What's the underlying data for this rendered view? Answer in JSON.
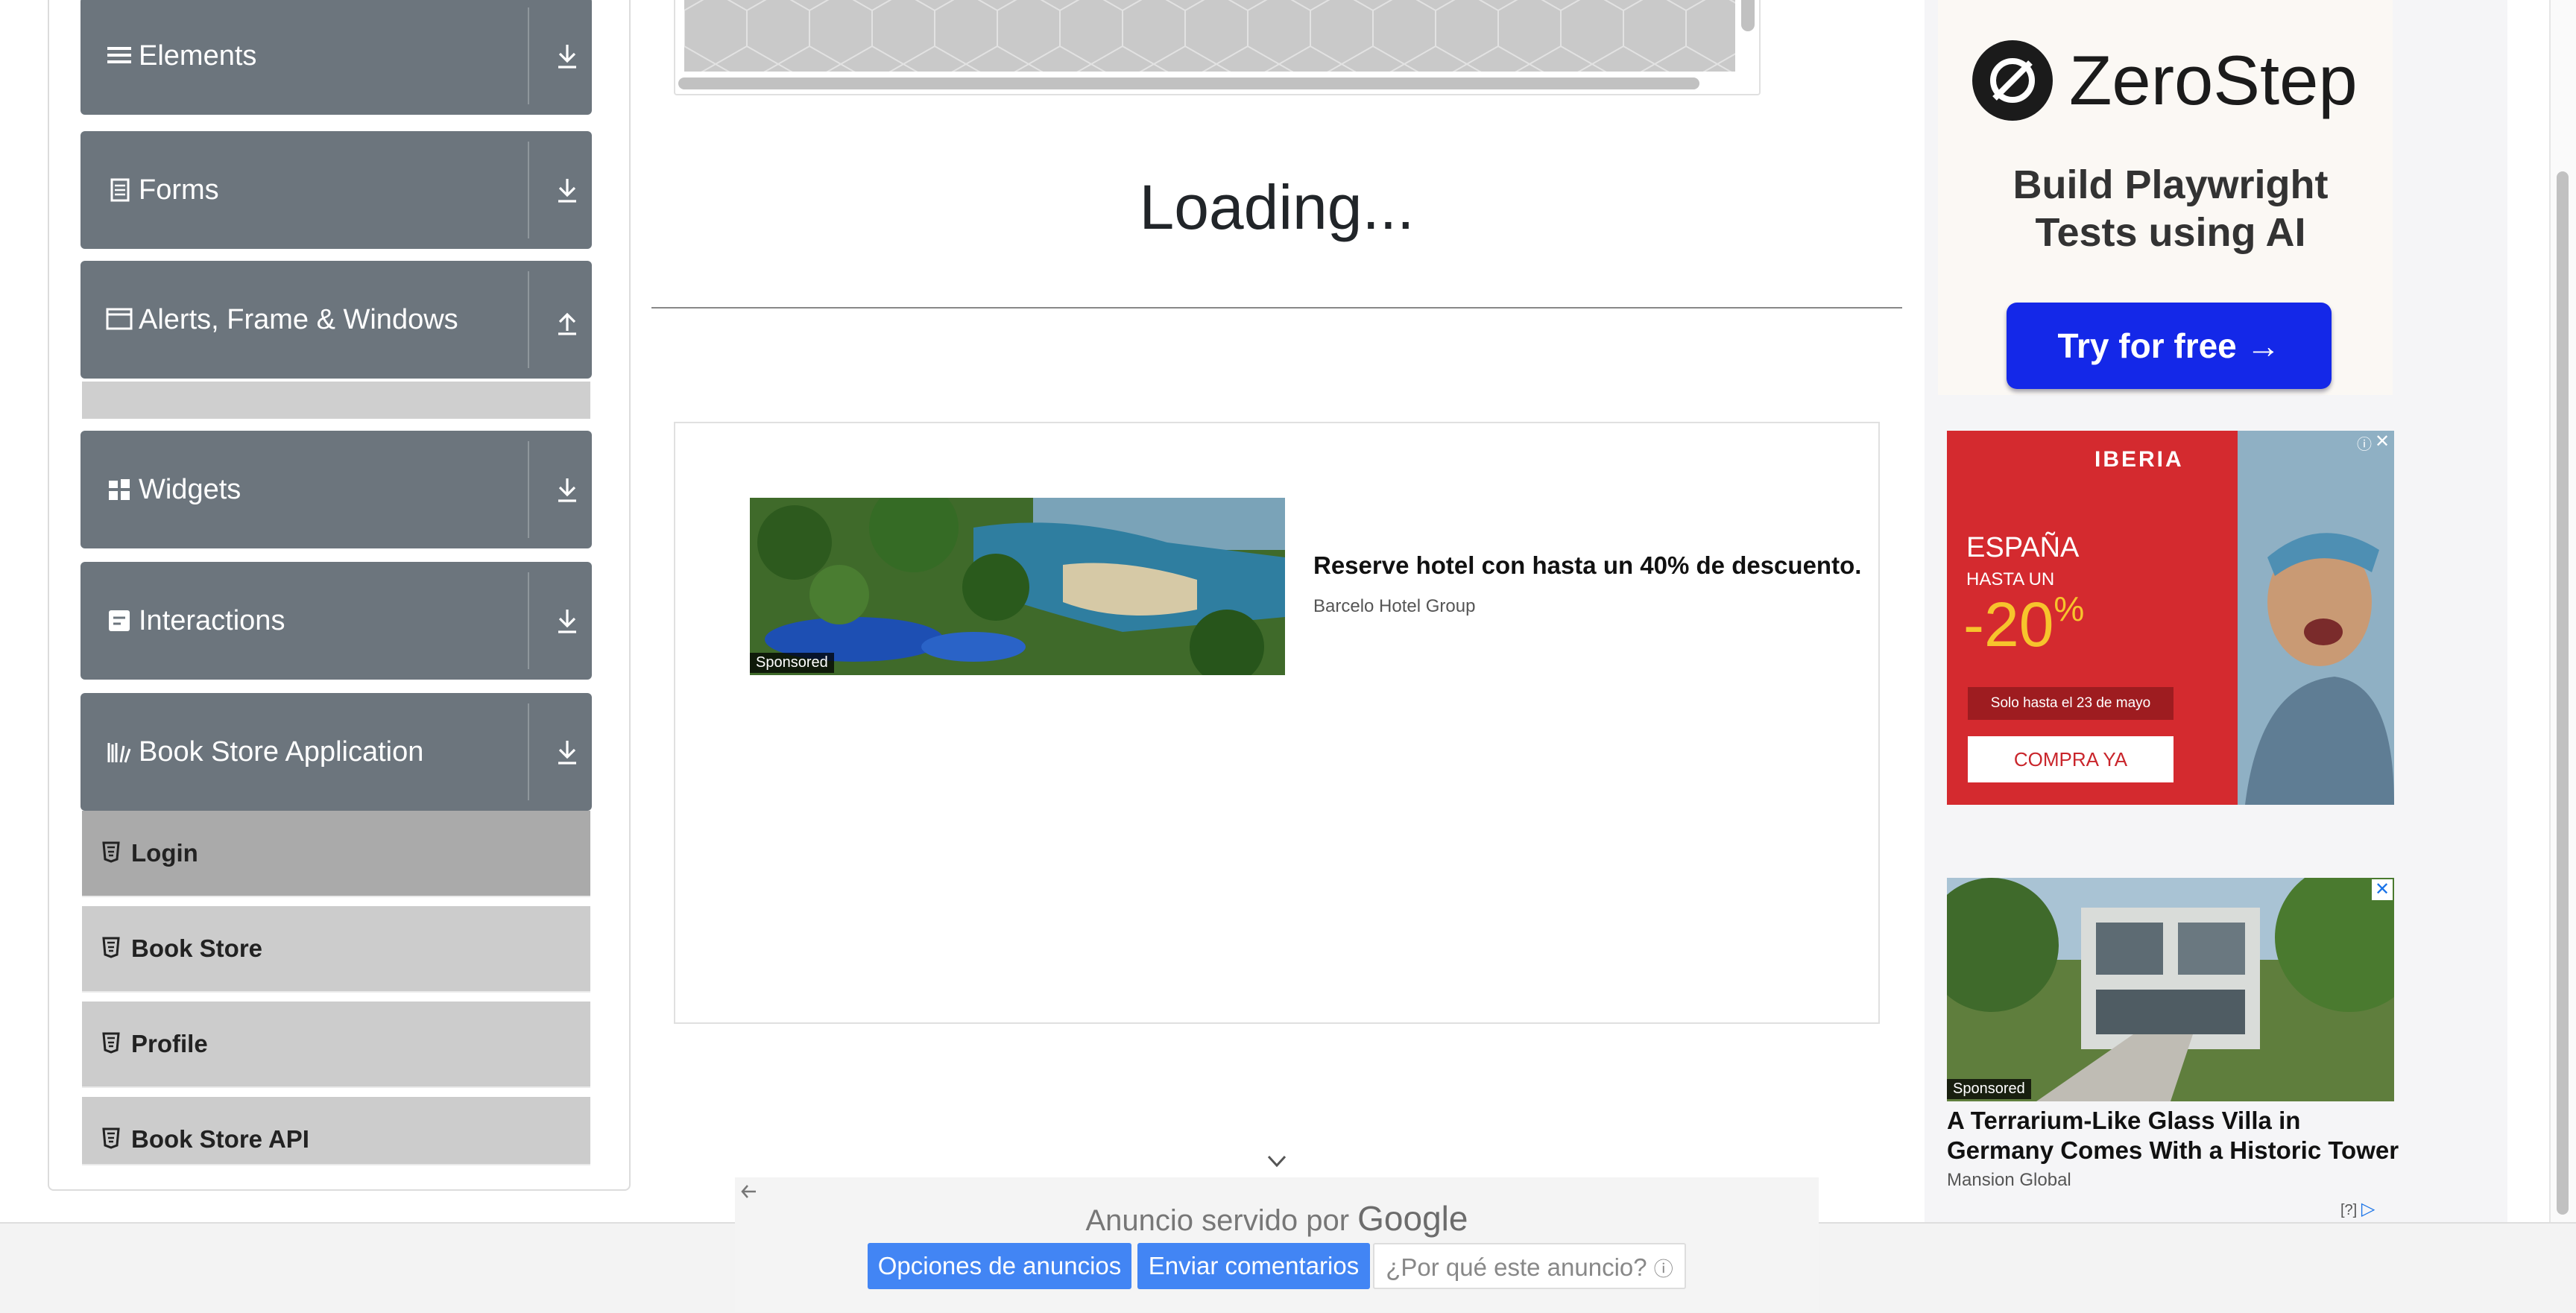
{
  "sidebar": {
    "groups": [
      {
        "label": "Elements",
        "icon": "hamburger-icon",
        "arrow": "download"
      },
      {
        "label": "Forms",
        "icon": "document-icon",
        "arrow": "download"
      },
      {
        "label": "Alerts, Frame & Windows",
        "icon": "window-icon",
        "arrow": "upload"
      },
      {
        "label": "Widgets",
        "icon": "widgets-icon",
        "arrow": "download"
      },
      {
        "label": "Interactions",
        "icon": "interactions-icon",
        "arrow": "download"
      },
      {
        "label": "Book Store Application",
        "icon": "library-icon",
        "arrow": "download"
      }
    ],
    "book_store_items": [
      "Login",
      "Book Store",
      "Profile",
      "Book Store API"
    ],
    "active_item": "Login"
  },
  "main": {
    "loading_text": "Loading...",
    "ad": {
      "sponsored": "Sponsored",
      "headline": "Reserve hotel con hasta un 40% de descuento.",
      "advertiser": "Barcelo Hotel Group"
    },
    "google_bar": {
      "served_by": "Anuncio servido por",
      "google": "Google",
      "btn_options": "Opciones de anuncios",
      "btn_feedback": "Enviar comentarios",
      "btn_why": "¿Por qué este anuncio?"
    }
  },
  "right": {
    "zerostep": {
      "brand": "ZeroStep",
      "tagline_1": "Build Playwright",
      "tagline_2": "Tests using AI",
      "cta": "Try for free →"
    },
    "iberia": {
      "brand": "IBERIA",
      "country": "ESPAÑA",
      "upto": "HASTA UN",
      "discount": "-20",
      "percent": "%",
      "validity": "Solo hasta el 23 de mayo",
      "cta": "COMPRA YA"
    },
    "villa": {
      "sponsored": "Sponsored",
      "title": "A Terrarium-Like Glass Villa in Germany Comes With a Historic Tower",
      "advertiser": "Mansion Global",
      "question": "[?]"
    }
  },
  "colors": {
    "sidebar_header": "#6c757d",
    "sidebar_item": "#cccccc",
    "sidebar_item_active": "#aaaaaa",
    "zerostep_button": "#1428e8",
    "google_button": "#4285f4",
    "iberia_red": "#d42a2f"
  }
}
